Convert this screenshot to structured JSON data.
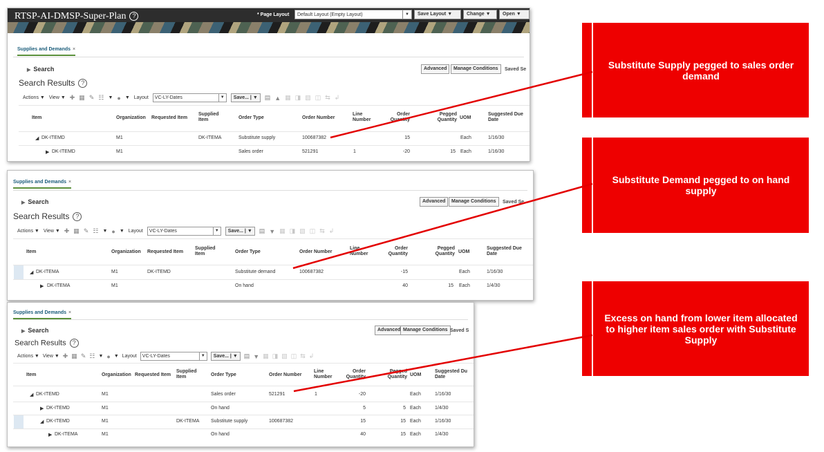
{
  "colors": {
    "callout_red": "#ee0000",
    "connector_red": "#e30000",
    "tab_underline": "#5a8f3a"
  },
  "panel1": {
    "title": "RTSP-AI-DMSP-Super-Plan",
    "help_icon": "?",
    "page_layout_label": "* Page Layout",
    "page_layout_value": "Default Layout (Empty Layout)",
    "save_layout": "Save Layout",
    "change": "Change",
    "open": "Open",
    "tab": "Supplies and Demands",
    "search": "Search",
    "advanced": "Advanced",
    "manage_conditions": "Manage Conditions",
    "saved": "Saved Se",
    "search_results": "Search Results",
    "actions": "Actions ▼",
    "view": "View ▼",
    "layout_label": "Layout",
    "layout_value": "VC-LY-Dates",
    "save_btn": "Save...",
    "headers": {
      "item": "Item",
      "org": "Organization",
      "req": "Requested Item",
      "sup1": "Supplied",
      "sup2": "Item",
      "type": "Order Type",
      "num": "Order Number",
      "line1": "Line",
      "line2": "Number",
      "qty1": "Order",
      "qty2": "Quantity",
      "peg1": "Pegged",
      "peg2": "Quantity",
      "uom": "UOM",
      "due1": "Suggested Due",
      "due2": "Date"
    },
    "rows": [
      {
        "item": "DK-ITEMD",
        "org": "M1",
        "req": "",
        "sup": "DK-ITEMA",
        "type": "Substitute supply",
        "num": "100687382",
        "line": "",
        "qty": "15",
        "peg": "",
        "uom": "Each",
        "due": "1/16/30"
      },
      {
        "item": "DK-ITEMD",
        "org": "M1",
        "req": "",
        "sup": "",
        "type": "Sales order",
        "num": "521291",
        "line": "1",
        "qty": "-20",
        "peg": "15",
        "uom": "Each",
        "due": "1/16/30"
      }
    ]
  },
  "panel2": {
    "tab": "Supplies and Demands",
    "search": "Search",
    "advanced": "Advanced",
    "manage_conditions": "Manage Conditions",
    "saved": "Saved Se",
    "search_results": "Search Results",
    "actions": "Actions ▼",
    "view": "View ▼",
    "layout_label": "Layout",
    "layout_value": "VC-LY-Dates",
    "save_btn": "Save...",
    "headers": {
      "item": "Item",
      "org": "Organization",
      "req": "Requested Item",
      "sup1": "Supplied",
      "sup2": "Item",
      "type": "Order Type",
      "num": "Order Number",
      "line1": "Line",
      "line2": "Number",
      "qty1": "Order",
      "qty2": "Quantity",
      "peg1": "Pegged",
      "peg2": "Quantity",
      "uom": "UOM",
      "due1": "Suggested Due",
      "due2": "Date"
    },
    "rows": [
      {
        "item": "DK-ITEMA",
        "org": "M1",
        "req": "DK-ITEMD",
        "sup": "",
        "type": "Substitute demand",
        "num": "100687382",
        "line": "",
        "qty": "-15",
        "peg": "",
        "uom": "Each",
        "due": "1/16/30"
      },
      {
        "item": "DK-ITEMA",
        "org": "M1",
        "req": "",
        "sup": "",
        "type": "On hand",
        "num": "",
        "line": "",
        "qty": "40",
        "peg": "15",
        "uom": "Each",
        "due": "1/4/30"
      }
    ]
  },
  "panel3": {
    "tab": "Supplies and Demands",
    "search": "Search",
    "advanced": "Advanced",
    "manage_conditions": "Manage Conditions",
    "saved": "Saved S",
    "search_results": "Search Results",
    "actions": "Actions ▼",
    "view": "View ▼",
    "layout_label": "Layout",
    "layout_value": "VC-LY-Dates",
    "save_btn": "Save...",
    "headers": {
      "item": "Item",
      "org": "Organization",
      "req": "Requested Item",
      "sup1": "Supplied",
      "sup2": "Item",
      "type": "Order Type",
      "num": "Order Number",
      "line1": "Line",
      "line2": "Number",
      "qty1": "Order",
      "qty2": "Quantity",
      "peg1": "Pegged",
      "peg2": "Quantity",
      "uom": "UOM",
      "due1": "Suggested Du",
      "due2": "Date"
    },
    "rows": [
      {
        "item": "DK-ITEMD",
        "org": "M1",
        "req": "",
        "sup": "",
        "type": "Sales order",
        "num": "521291",
        "line": "1",
        "qty": "-20",
        "peg": "",
        "uom": "Each",
        "due": "1/16/30"
      },
      {
        "item": "DK-ITEMD",
        "org": "M1",
        "req": "",
        "sup": "",
        "type": "On hand",
        "num": "",
        "line": "",
        "qty": "5",
        "peg": "5",
        "uom": "Each",
        "due": "1/4/30"
      },
      {
        "item": "DK-ITEMD",
        "org": "M1",
        "req": "",
        "sup": "DK-ITEMA",
        "type": "Substitute supply",
        "num": "100687382",
        "line": "",
        "qty": "15",
        "peg": "15",
        "uom": "Each",
        "due": "1/16/30"
      },
      {
        "item": "DK-ITEMA",
        "org": "M1",
        "req": "",
        "sup": "",
        "type": "On hand",
        "num": "",
        "line": "",
        "qty": "40",
        "peg": "15",
        "uom": "Each",
        "due": "1/4/30"
      }
    ]
  },
  "callouts": [
    "Substitute Supply pegged to sales order demand",
    "Substitute Demand pegged to on hand supply",
    "Excess on hand from lower item allocated to higher item sales order with Substitute Supply"
  ]
}
